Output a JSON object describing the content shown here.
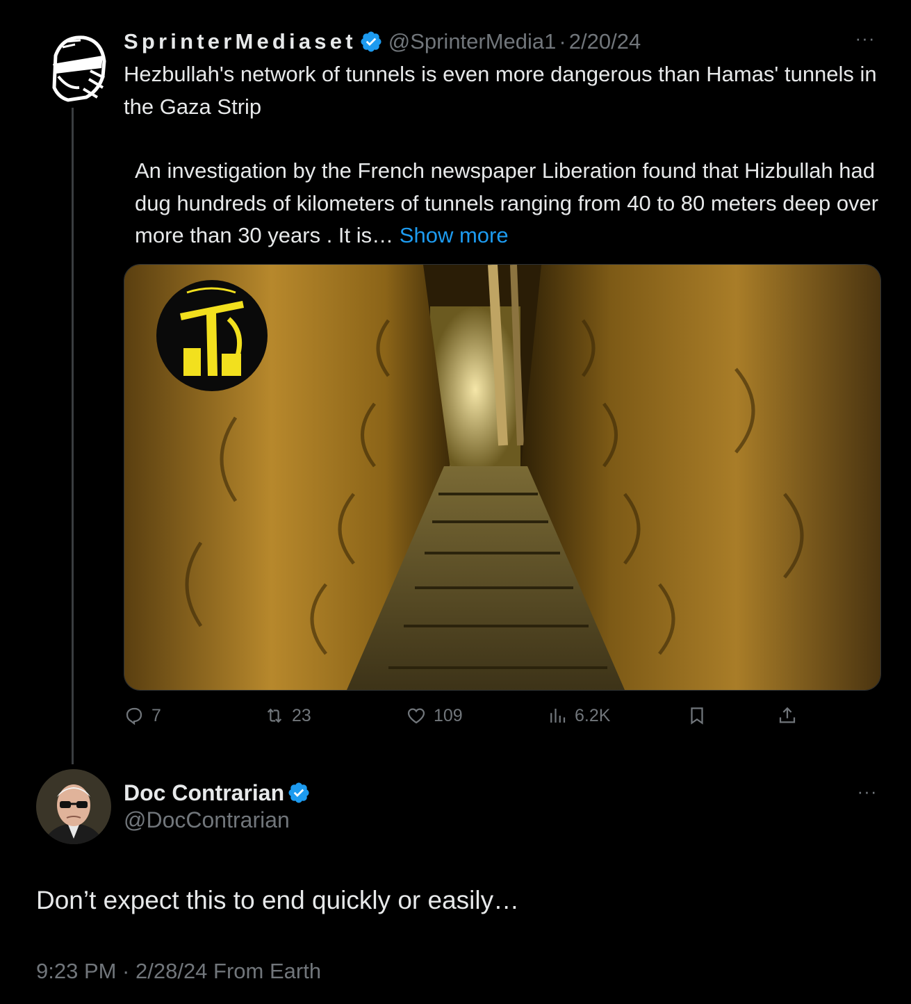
{
  "parent_tweet": {
    "author_name": "SprinterMediaset",
    "handle": "@SprinterMedia1",
    "separator": "·",
    "date": "2/20/24",
    "more_label": "···",
    "text_line1": "Hezbullah's network of tunnels is even more dangerous than Hamas' tunnels in the Gaza Strip",
    "text_line2": "An investigation by the French newspaper Liberation found that Hizbullah had dug hundreds of kilometers of tunnels ranging from 40 to 80 meters deep over more than 30 years . It is…",
    "show_more": "Show more",
    "media_icon": "tunnel-photo-with-hezbollah-logo",
    "actions": {
      "replies": "7",
      "reposts": "23",
      "likes": "109",
      "views": "6.2K"
    }
  },
  "reply_tweet": {
    "author_name": "Doc Contrarian",
    "handle": "@DocContrarian",
    "more_label": "···",
    "text": "Don’t expect this to end quickly or easily…",
    "meta": "9:23 PM · 2/28/24 From Earth"
  },
  "colors": {
    "background": "#000000",
    "text_primary": "#e7e9ea",
    "text_secondary": "#71767b",
    "link": "#1d9bf0",
    "verified": "#1d9bf0"
  }
}
